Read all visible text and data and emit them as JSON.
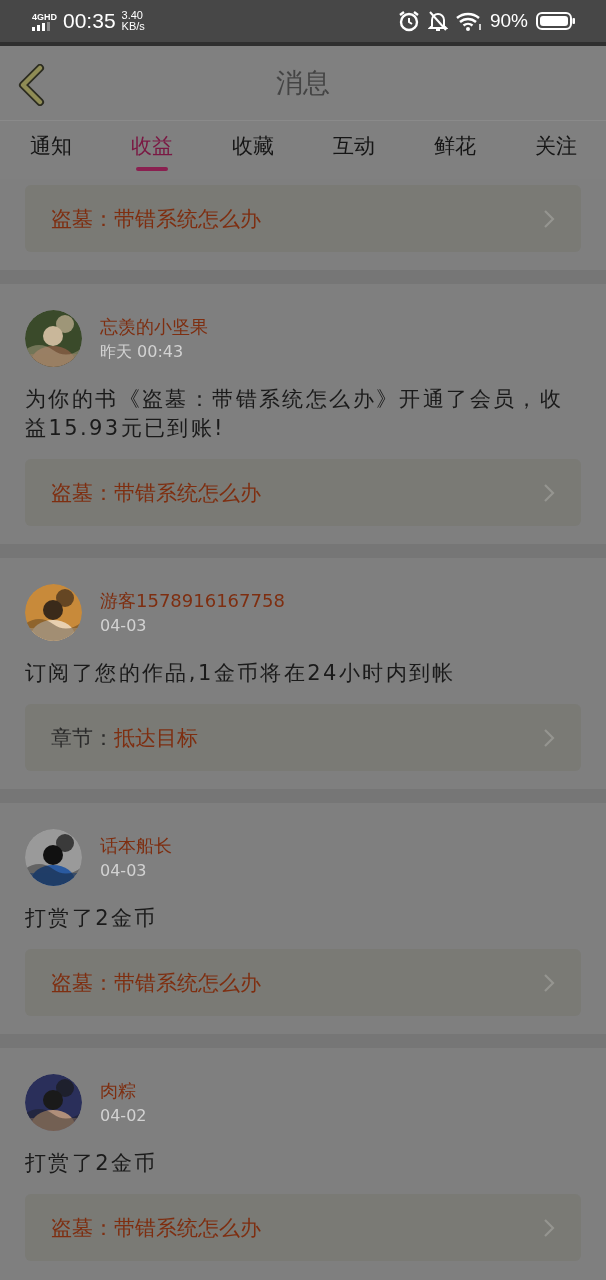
{
  "status_bar": {
    "network": "4GHD",
    "time": "00:35",
    "speed_value": "3.40",
    "speed_unit": "KB/s",
    "battery": "90%"
  },
  "header": {
    "title": "消息"
  },
  "tabs": [
    {
      "label": "通知",
      "selected": false
    },
    {
      "label": "收益",
      "selected": true
    },
    {
      "label": "收藏",
      "selected": false
    },
    {
      "label": "互动",
      "selected": false
    },
    {
      "label": "鲜花",
      "selected": false
    },
    {
      "label": "关注",
      "selected": false
    }
  ],
  "messages": [
    {
      "partial": true,
      "link": {
        "title": "盗墓：带错系统怎么办"
      }
    },
    {
      "partial": false,
      "user": "忘羡的小坚果",
      "time": "昨天 00:43",
      "text": "为你的书《盗墓：带错系统怎么办》开通了会员，收益15.93元已到账!",
      "link": {
        "title": "盗墓：带错系统怎么办"
      }
    },
    {
      "partial": false,
      "user": "游客1578916167758",
      "time": "04-03",
      "text": "订阅了您的作品,1金币将在24小时内到帐",
      "link": {
        "label": "章节：",
        "title": "抵达目标"
      }
    },
    {
      "partial": false,
      "user": "话本船长",
      "time": "04-03",
      "text": "打赏了2金币",
      "link": {
        "title": "盗墓：带错系统怎么办"
      }
    },
    {
      "partial": false,
      "user": "肉粽",
      "time": "04-02",
      "text": "打赏了2金币",
      "link": {
        "title": "盗墓：带错系统怎么办"
      }
    }
  ]
}
